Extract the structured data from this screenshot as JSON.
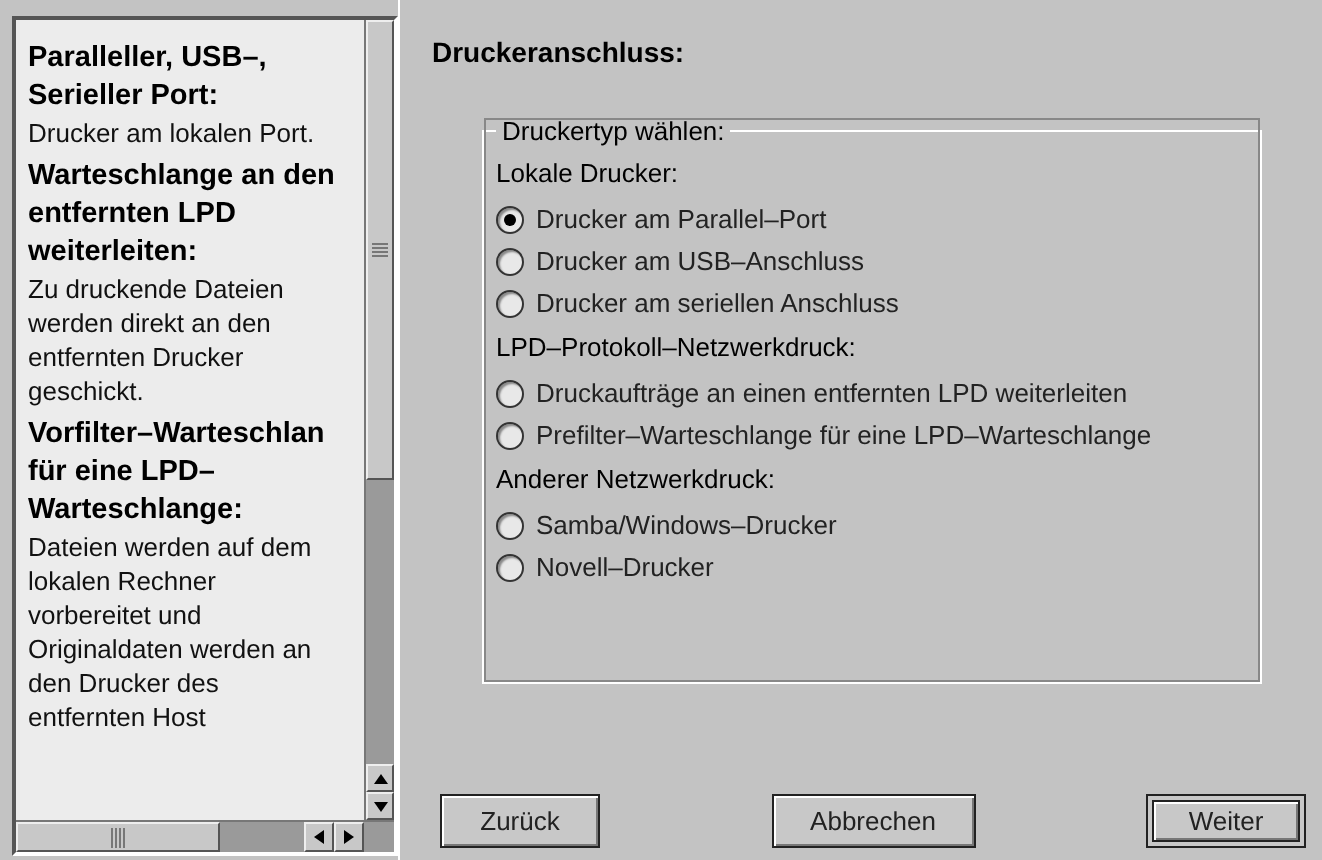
{
  "help": [
    {
      "title": "Paralleller, USB–, Serieller Port:",
      "text": "Drucker am lokalen Port."
    },
    {
      "title": "Warteschlange an den entfernten LPD weiterleiten:",
      "text": "Zu druckende Dateien werden direkt an den entfernten Drucker geschickt."
    },
    {
      "title": "Vorfilter–Warteschlan für eine LPD–Warteschlange:",
      "text": "Dateien werden auf dem lokalen Rechner vorbereitet und Originaldaten werden an den Drucker des entfernten Host"
    }
  ],
  "page_title": "Druckeranschluss:",
  "group": {
    "legend": "Druckertyp wählen:",
    "items": [
      {
        "kind": "heading",
        "label": "Lokale Drucker:"
      },
      {
        "kind": "radio",
        "label": "Drucker am Parallel–Port",
        "selected": true
      },
      {
        "kind": "radio",
        "label": "Drucker am USB–Anschluss",
        "selected": false
      },
      {
        "kind": "radio",
        "label": "Drucker am seriellen Anschluss",
        "selected": false
      },
      {
        "kind": "heading",
        "label": "LPD–Protokoll–Netzwerkdruck:"
      },
      {
        "kind": "radio",
        "label": "Druckaufträge an einen entfernten LPD weiterleiten",
        "selected": false
      },
      {
        "kind": "radio",
        "label": "Prefilter–Warteschlange für eine LPD–Warteschlange",
        "selected": false
      },
      {
        "kind": "heading",
        "label": "Anderer Netzwerkdruck:"
      },
      {
        "kind": "radio",
        "label": "Samba/Windows–Drucker",
        "selected": false
      },
      {
        "kind": "radio",
        "label": "Novell–Drucker",
        "selected": false
      }
    ]
  },
  "buttons": [
    {
      "label": "Zurück",
      "default": false
    },
    {
      "label": "Abbrechen",
      "default": false
    },
    {
      "label": "Weiter",
      "default": true
    }
  ]
}
